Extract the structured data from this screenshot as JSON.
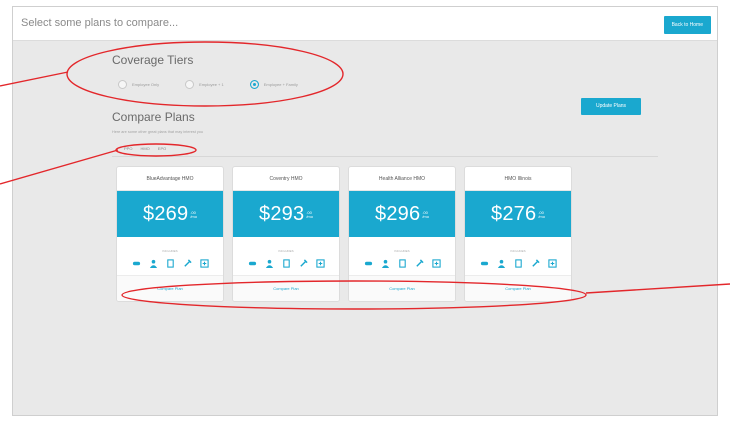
{
  "header": {
    "title": "Select some plans to compare...",
    "home_button": "Back to Home"
  },
  "coverage": {
    "title": "Coverage Tiers",
    "tiers": [
      {
        "label": "Employee Only",
        "selected": false
      },
      {
        "label": "Employee + 1",
        "selected": false
      },
      {
        "label": "Employee + Family",
        "selected": true
      }
    ]
  },
  "compare": {
    "title": "Compare Plans",
    "subtitle": "Here are some other great plans that may interest you",
    "update_button": "Update Plans",
    "filters": [
      "PPO",
      "HMO",
      "EPO"
    ],
    "includes_label": "INCLUDES",
    "compare_label": "Compare Plan",
    "plans": [
      {
        "name": "BlueAdvantage HMO",
        "price": "$269",
        "cents": ".00",
        "unit": "/mo"
      },
      {
        "name": "Coventry HMO",
        "price": "$293",
        "cents": ".00",
        "unit": "/mo"
      },
      {
        "name": "Health Alliance HMO",
        "price": "$296",
        "cents": ".00",
        "unit": "/mo"
      },
      {
        "name": "HMO Illinois",
        "price": "$276",
        "cents": ".00",
        "unit": "/mo"
      }
    ]
  },
  "colors": {
    "accent": "#1aa8cf",
    "annotation": "#e3272b"
  },
  "icons": [
    "pill-icon",
    "doctor-icon",
    "document-icon",
    "syringe-icon",
    "hospital-icon"
  ]
}
